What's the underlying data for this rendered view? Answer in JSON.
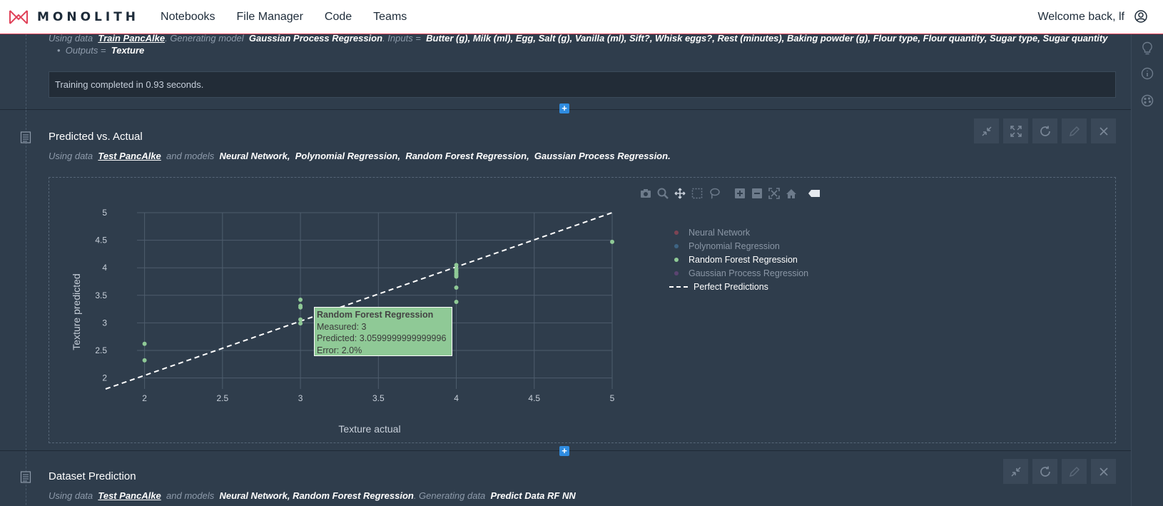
{
  "nav": {
    "brand": "MONOLITH",
    "links": [
      "Notebooks",
      "File Manager",
      "Code",
      "Teams"
    ],
    "welcome": "Welcome back, lf"
  },
  "colors": {
    "accent_red": "#e0435a",
    "background": "#2f3d4c",
    "nn": "#b24a5a",
    "poly": "#4a7fa8",
    "rf": "#8fc996",
    "gp": "#7a4a8a",
    "button_blue": "#2f8ce0"
  },
  "training_cell": {
    "desc_prefix": "Using data",
    "dataset": "Train PancAlke",
    "desc_mid": ". Generating model",
    "model": "Gaussian Process Regression",
    "inputs_label": ". Inputs =",
    "inputs": "Butter (g), Milk (ml), Egg, Salt (g), Vanilla (ml), Sift?, Whisk eggs?, Rest (minutes), Baking powder (g), Flour type, Flour quantity, Sugar type, Sugar quantity",
    "outputs_label": "Outputs =",
    "outputs": "Texture",
    "result": "Training completed in 0.93 seconds."
  },
  "pva_cell": {
    "title": "Predicted vs. Actual",
    "desc_prefix": "Using data",
    "dataset": "Test PancAlke",
    "desc_mid": "and models",
    "models": [
      "Neural Network,",
      "Polynomial Regression,",
      "Random Forest Regression,",
      "Gaussian Process Regression."
    ]
  },
  "dataset_cell": {
    "title": "Dataset Prediction",
    "desc_prefix": "Using data",
    "dataset": "Test PancAlke",
    "desc_mid": "and models",
    "models": "Neural Network, Random Forest Regression",
    "gen_label": ". Generating data",
    "gen_data": "Predict Data RF NN"
  },
  "tooltip": {
    "title": "Random Forest Regression",
    "measured": "Measured: 3",
    "predicted": "Predicted: 3.0599999999999996",
    "error": "Error: 2.0%"
  },
  "icons": {
    "toolbar": [
      "collapse-icon",
      "expand-icon",
      "refresh-icon",
      "edit-icon",
      "close-icon"
    ],
    "modebar": [
      "camera-icon",
      "zoom-icon",
      "pan-icon",
      "box-select-icon",
      "lasso-icon",
      "zoom-in-icon",
      "zoom-out-icon",
      "autoscale-icon",
      "reset-axes-icon",
      "plotly-logo-icon"
    ],
    "rightbar": [
      "lightbulb-icon",
      "info-icon",
      "palette-icon"
    ]
  },
  "chart_data": {
    "type": "scatter",
    "xlabel": "Texture actual",
    "ylabel": "Texture predicted",
    "xlim": [
      1.75,
      5
    ],
    "ylim": [
      1.8,
      5
    ],
    "xticks": [
      2,
      2.5,
      3,
      3.5,
      4,
      4.5,
      5
    ],
    "yticks": [
      2,
      2.5,
      3,
      3.5,
      4,
      4.5,
      5
    ],
    "grid": true,
    "legend_position": "right",
    "series": [
      {
        "name": "Neural Network",
        "color": "#b24a5a",
        "visible": false,
        "points": []
      },
      {
        "name": "Polynomial Regression",
        "color": "#4a7fa8",
        "visible": false,
        "points": []
      },
      {
        "name": "Random Forest Regression",
        "color": "#8fc996",
        "visible": true,
        "points": [
          [
            2,
            2.62
          ],
          [
            2,
            2.32
          ],
          [
            3,
            3.42
          ],
          [
            3,
            3.31
          ],
          [
            3,
            3.28
          ],
          [
            3,
            3.06
          ],
          [
            3,
            2.99
          ],
          [
            4,
            4.05
          ],
          [
            4,
            3.98
          ],
          [
            4,
            3.94
          ],
          [
            4,
            3.9
          ],
          [
            4,
            3.87
          ],
          [
            4,
            3.84
          ],
          [
            4,
            3.64
          ],
          [
            4,
            3.38
          ],
          [
            5,
            4.47
          ]
        ]
      },
      {
        "name": "Gaussian Process Regression",
        "color": "#7a4a8a",
        "visible": false,
        "points": []
      },
      {
        "name": "Perfect Predictions",
        "type": "line",
        "dash": true,
        "color": "#ffffff",
        "points": [
          [
            1.75,
            1.8
          ],
          [
            5,
            5
          ]
        ]
      }
    ]
  }
}
